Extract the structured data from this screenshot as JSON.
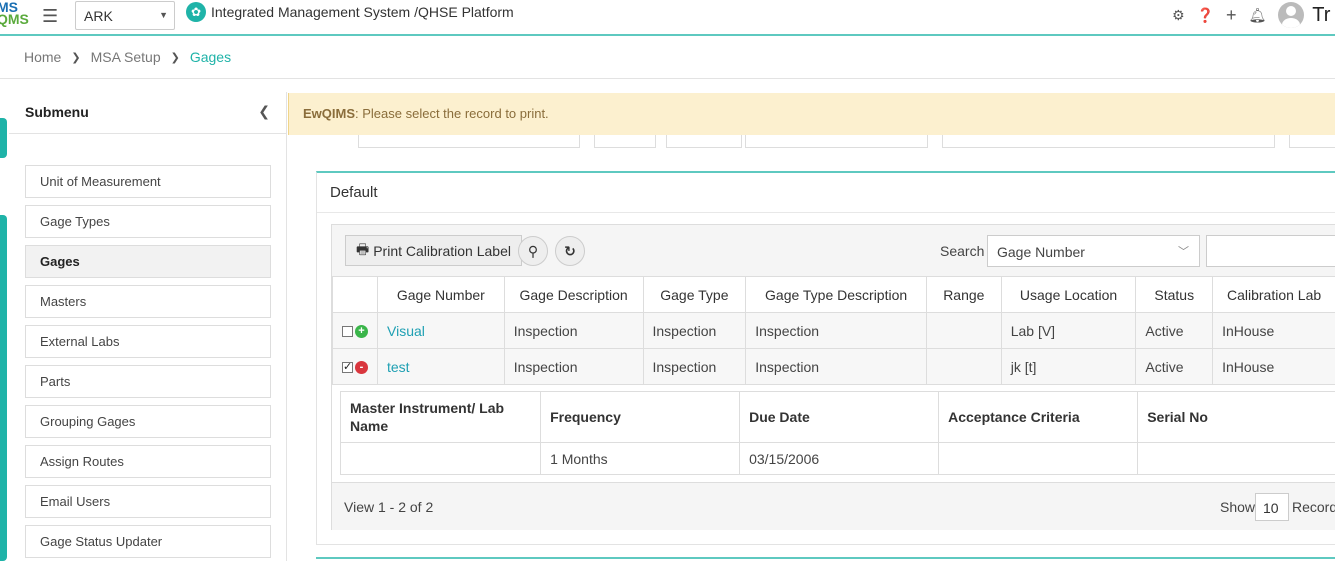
{
  "header": {
    "logo_top": "MS",
    "logo_bottom": "QMS",
    "org": "ARK",
    "app_title": "Integrated Management System /QHSE Platform",
    "user_initials": "Tr",
    "icons": [
      "hamburger-icon",
      "gear-icon",
      "help-icon",
      "plus-icon",
      "bell-icon",
      "avatar"
    ]
  },
  "breadcrumb": [
    "Home",
    "MSA Setup",
    "Gages"
  ],
  "sidebar": {
    "title": "Submenu",
    "items": [
      {
        "label": "Unit of Measurement",
        "active": false
      },
      {
        "label": "Gage Types",
        "active": false
      },
      {
        "label": "Gages",
        "active": true
      },
      {
        "label": "Masters",
        "active": false
      },
      {
        "label": "External Labs",
        "active": false
      },
      {
        "label": "Parts",
        "active": false
      },
      {
        "label": "Grouping Gages",
        "active": false
      },
      {
        "label": "Assign Routes",
        "active": false
      },
      {
        "label": "Email Users",
        "active": false
      },
      {
        "label": "Gage Status Updater",
        "active": false
      }
    ]
  },
  "alert": {
    "brand": "EwQIMS",
    "message": ": Please select the record to print."
  },
  "panel": {
    "title": "Default",
    "print_label": "Print Calibration Label",
    "search_label": "Search",
    "search_field": "Gage Number"
  },
  "grid": {
    "columns": [
      "Gage Number",
      "Gage Description",
      "Gage Type",
      "Gage Type Description",
      "Range",
      "Usage Location",
      "Status",
      "Calibration Lab"
    ],
    "rows": [
      {
        "checked": false,
        "expanded": false,
        "gage_number": "Visual",
        "gage_description": "Inspection",
        "gage_type": "Inspection",
        "gage_type_description": "Inspection",
        "range": "",
        "usage_location": "Lab [V]",
        "status": "Active",
        "calibration_lab": "InHouse"
      },
      {
        "checked": true,
        "expanded": true,
        "gage_number": "test",
        "gage_description": "Inspection",
        "gage_type": "Inspection",
        "gage_type_description": "Inspection",
        "range": "",
        "usage_location": "jk [t]",
        "status": "Active",
        "calibration_lab": "InHouse"
      }
    ]
  },
  "subgrid": {
    "columns": [
      "Master Instrument/ Lab Name",
      "Frequency",
      "Due Date",
      "Acceptance Criteria",
      "Serial No"
    ],
    "rows": [
      {
        "master": "",
        "frequency": "1 Months",
        "due_date": "03/15/2006",
        "acceptance": "",
        "serial": ""
      }
    ]
  },
  "footer": {
    "view_count": "View 1 - 2 of 2",
    "show_label": "Show",
    "page_size": "10",
    "records_label": "Records"
  },
  "colors": {
    "accent": "#1fb3a8",
    "alert_bg": "#fcf0cf",
    "active_item_bg": "#f2f2f2"
  }
}
